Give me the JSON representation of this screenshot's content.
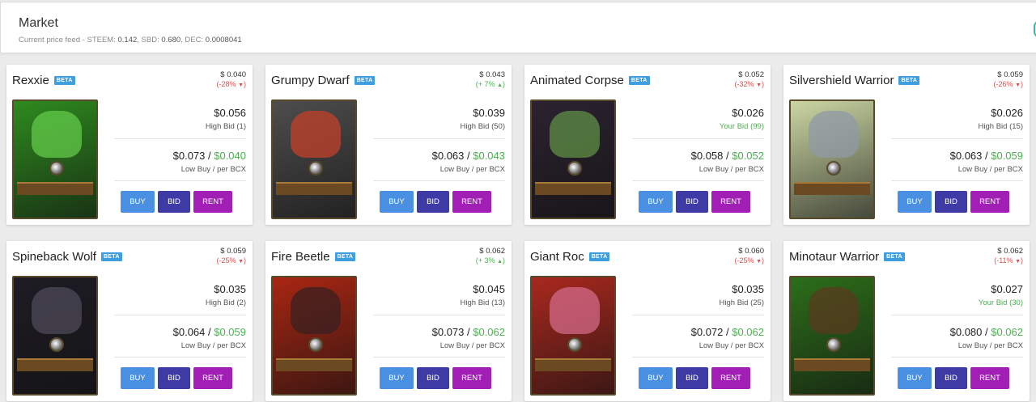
{
  "header": {
    "title": "Market",
    "feed_label": "Current price feed - ",
    "steem_label": "STEEM: ",
    "steem": "0.142",
    "sbd_label": ", SBD: ",
    "sbd": "0.680",
    "dec_label": ", DEC: ",
    "dec": "0.0008041"
  },
  "labels": {
    "buy": "BUY",
    "bid": "BID",
    "rent": "RENT",
    "beta": "BETA",
    "per_bcx": "Low Buy / per BCX",
    "sep": " / "
  },
  "cards": [
    {
      "name": "Rexxie",
      "price": "$ 0.040",
      "change": "-28%",
      "dir": "down",
      "bid": "$0.056",
      "bid_label": "High Bid (1)",
      "bid_yours": false,
      "low": "$0.073",
      "per": "$0.040",
      "art_bg": "#2e8a1e",
      "art_fig": "#62c94a"
    },
    {
      "name": "Grumpy Dwarf",
      "price": "$ 0.043",
      "change": "+ 7%",
      "dir": "up",
      "bid": "$0.039",
      "bid_label": "High Bid (50)",
      "bid_yours": false,
      "low": "$0.063",
      "per": "$0.043",
      "art_bg": "#4d4d4d",
      "art_fig": "#c3402a"
    },
    {
      "name": "Animated Corpse",
      "price": "$ 0.052",
      "change": "-32%",
      "dir": "down",
      "bid": "$0.026",
      "bid_label": "Your Bid (99)",
      "bid_yours": true,
      "low": "$0.058",
      "per": "$0.052",
      "art_bg": "#2b2230",
      "art_fig": "#5f8f46"
    },
    {
      "name": "Silvershield Warrior",
      "price": "$ 0.059",
      "change": "-26%",
      "dir": "down",
      "bid": "$0.026",
      "bid_label": "High Bid (15)",
      "bid_yours": false,
      "low": "$0.063",
      "per": "$0.059",
      "art_bg": "#cbd6a3",
      "art_fig": "#8f9aa5"
    },
    {
      "name": "Spineback Wolf",
      "price": "$ 0.059",
      "change": "-25%",
      "dir": "down",
      "bid": "$0.035",
      "bid_label": "High Bid (2)",
      "bid_yours": false,
      "low": "$0.064",
      "per": "$0.059",
      "art_bg": "#1e1c24",
      "art_fig": "#4e4a58"
    },
    {
      "name": "Fire Beetle",
      "price": "$ 0.062",
      "change": "+ 3%",
      "dir": "up",
      "bid": "$0.045",
      "bid_label": "High Bid (13)",
      "bid_yours": false,
      "low": "$0.073",
      "per": "$0.062",
      "art_bg": "#a82612",
      "art_fig": "#3a2020"
    },
    {
      "name": "Giant Roc",
      "price": "$ 0.060",
      "change": "-25%",
      "dir": "down",
      "bid": "$0.035",
      "bid_label": "High Bid (25)",
      "bid_yours": false,
      "low": "$0.072",
      "per": "$0.062",
      "art_bg": "#a8281e",
      "art_fig": "#d26a8a"
    },
    {
      "name": "Minotaur Warrior",
      "price": "$ 0.062",
      "change": "-11%",
      "dir": "down",
      "bid": "$0.027",
      "bid_label": "Your Bid (30)",
      "bid_yours": true,
      "low": "$0.080",
      "per": "$0.062",
      "art_bg": "#2c6e1a",
      "art_fig": "#5a3a1e"
    }
  ]
}
